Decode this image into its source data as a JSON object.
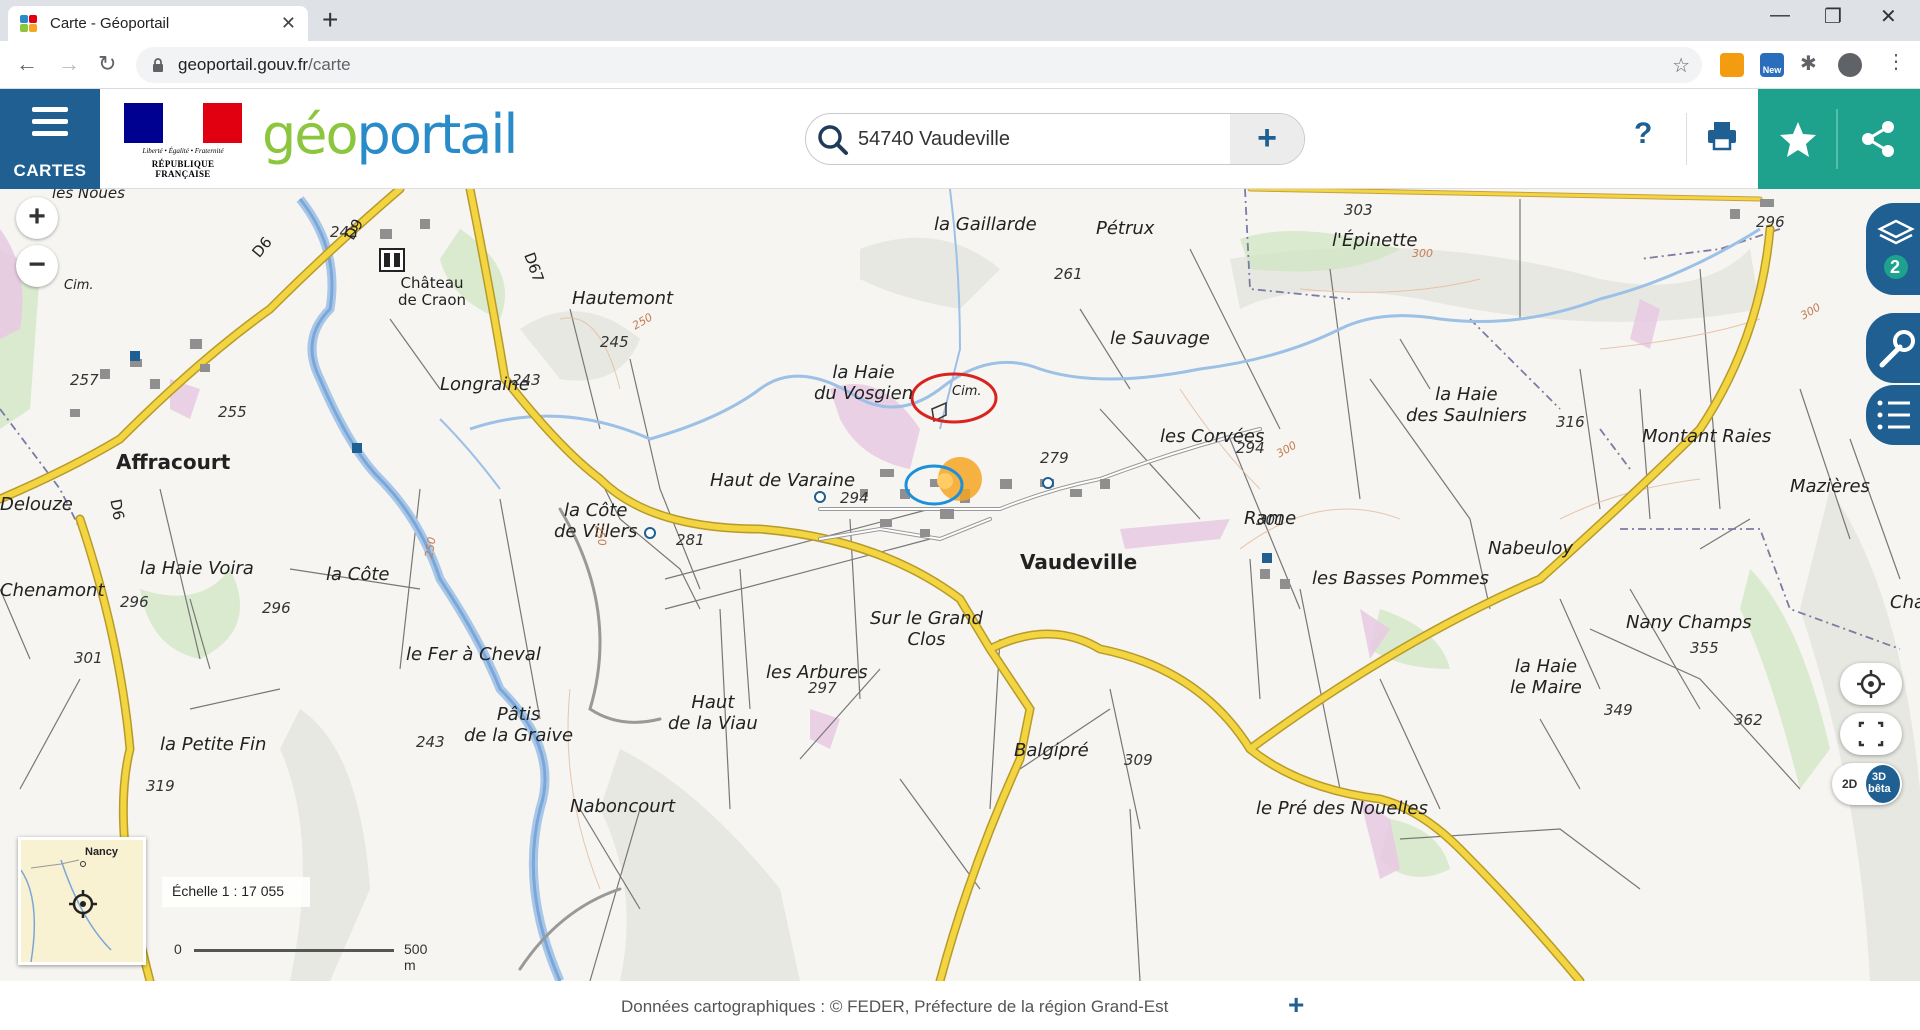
{
  "browser": {
    "tab_title": "Carte - Géoportail",
    "tab_close": "✕",
    "new_tab": "+",
    "url_host": "geoportail.gouv.fr",
    "url_path": "/carte",
    "new_badge": "New"
  },
  "header": {
    "menu_label": "CARTES",
    "rf_motto": "Liberté • Égalité • Fraternité",
    "rf_name": "RÉPUBLIQUE FRANÇAISE",
    "logo_geo": "géo",
    "logo_portail": "portail",
    "search_value": "54740 Vaudeville",
    "search_plus": "+",
    "help": "?"
  },
  "map": {
    "places": [
      {
        "id": "gaillarde",
        "text": "la Gaillarde"
      },
      {
        "id": "petrux",
        "text": "Pétrux"
      },
      {
        "id": "hautemont",
        "text": "Hautemont"
      },
      {
        "id": "epinette",
        "text": "l'Épinette"
      },
      {
        "id": "sauvage",
        "text": "le Sauvage"
      },
      {
        "id": "chateau",
        "text": "Château\nde Craon"
      },
      {
        "id": "longraine",
        "text": "Longraine"
      },
      {
        "id": "haievosgien",
        "text": "la Haie\ndu Vosgien"
      },
      {
        "id": "haiesaulniers",
        "text": "la Haie\ndes Saulniers"
      },
      {
        "id": "montantraies",
        "text": "Montant Raies"
      },
      {
        "id": "mazieres",
        "text": "Mazières"
      },
      {
        "id": "corvees",
        "text": "les Corvées"
      },
      {
        "id": "affracourt",
        "text": "Affracourt"
      },
      {
        "id": "hautvaraine",
        "text": "Haut de Varaine"
      },
      {
        "id": "cotevillers",
        "text": "la Côte\nde Villers"
      },
      {
        "id": "rame",
        "text": "Rame"
      },
      {
        "id": "nabeuloy",
        "text": "Nabeuloy"
      },
      {
        "id": "delouze",
        "text": "Delouze"
      },
      {
        "id": "vaudeville",
        "text": "Vaudeville"
      },
      {
        "id": "bassespommes",
        "text": "les Basses Pommes"
      },
      {
        "id": "haievoira",
        "text": "la Haie Voira"
      },
      {
        "id": "lacote",
        "text": "la Côte"
      },
      {
        "id": "chenamont",
        "text": "Chenamont"
      },
      {
        "id": "grandclos",
        "text": "Sur le Grand\nClos"
      },
      {
        "id": "nanychamps",
        "text": "Nany Champs"
      },
      {
        "id": "cha",
        "text": "Cha"
      },
      {
        "id": "arbures",
        "text": "les Arbures"
      },
      {
        "id": "fercheval",
        "text": "le Fer à Cheval"
      },
      {
        "id": "haiemaire",
        "text": "la Haie\nle Maire"
      },
      {
        "id": "hautviau",
        "text": "Haut\nde la Viau"
      },
      {
        "id": "patis",
        "text": "Pâtis\nde la Graive"
      },
      {
        "id": "petitefin",
        "text": "la Petite Fin"
      },
      {
        "id": "balgipre",
        "text": "Balgipré"
      },
      {
        "id": "naboncourt",
        "text": "Naboncourt"
      },
      {
        "id": "prenouelles",
        "text": "le Pré des Nouelles"
      },
      {
        "id": "noues",
        "text": "les Noues"
      },
      {
        "id": "cim1",
        "text": "Cim."
      },
      {
        "id": "cim2",
        "text": "Cim."
      }
    ],
    "elevations": [
      "303",
      "296",
      "261",
      "242",
      "245",
      "243",
      "257",
      "255",
      "294",
      "279",
      "294",
      "301",
      "316",
      "281",
      "296",
      "296",
      "301",
      "297",
      "355",
      "349",
      "362",
      "243",
      "309",
      "319",
      "309"
    ],
    "contours": [
      "300",
      "250",
      "250",
      "250",
      "300",
      "300"
    ],
    "roads": [
      "D6",
      "D67",
      "D9",
      "D6"
    ],
    "zoom_in": "+",
    "zoom_out": "−",
    "layers_count": "2",
    "overview_label": "Nancy",
    "scale_text": "Échelle 1 : 17 055",
    "scale_zero": "0",
    "scale_max": "500 m",
    "btn_2d": "2D",
    "btn_3d": "3D",
    "btn_beta": "bêta"
  },
  "footer": {
    "text": "Données cartographiques :  ©     FEDER,  Préfecture de la région Grand-Est",
    "plus": "+"
  },
  "colors": {
    "navy": "#1f5f91",
    "teal": "#1ea28d",
    "road_yellow": "#f2d540",
    "river": "#7aa7d8",
    "marker_orange": "#f5a623",
    "circle_red": "#d9231e",
    "circle_blue": "#1e8fd9"
  }
}
